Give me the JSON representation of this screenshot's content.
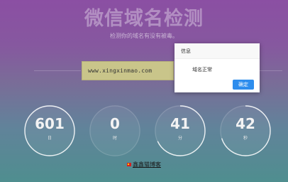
{
  "header": {
    "title": "微信域名检测",
    "subtitle": "检测你的域名有没有被毒。"
  },
  "search": {
    "domain_value": "www.xingxinmao.com"
  },
  "dialog": {
    "title": "信息",
    "message": "域名正常",
    "confirm_label": "确定"
  },
  "countdown": [
    {
      "value": "601",
      "unit": "日",
      "progress": 1.0
    },
    {
      "value": "0",
      "unit": "时",
      "progress": 0.0
    },
    {
      "value": "41",
      "unit": "分",
      "progress": 0.68
    },
    {
      "value": "42",
      "unit": "秒",
      "progress": 0.7
    }
  ],
  "footer": {
    "link_text": "鑫鑫猫博客"
  },
  "colors": {
    "ring": "#ffffff",
    "dialog_button": "#2e8ded",
    "domain_box": "#c9c58a"
  }
}
